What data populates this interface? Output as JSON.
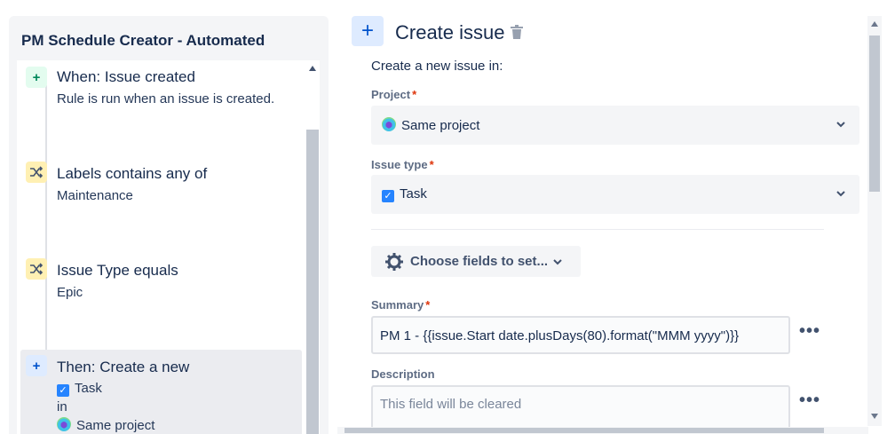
{
  "rule": {
    "title": "PM Schedule Creator - Automated",
    "steps": [
      {
        "icon": "plus-icon",
        "title": "When: Issue created",
        "subtitle": "Rule is run when an issue is created."
      },
      {
        "icon": "shuffle-icon",
        "title": "Labels contains any of",
        "subtitle": "Maintenance"
      },
      {
        "icon": "shuffle-icon",
        "title": "Issue Type equals",
        "subtitle": "Epic"
      },
      {
        "icon": "plus-icon",
        "title": "Then: Create a new",
        "line1": "Task",
        "line2": "in",
        "line3": "Same project"
      }
    ]
  },
  "panel": {
    "add_icon": "+",
    "title": "Create issue",
    "intro": "Create a new issue in:",
    "project_label": "Project",
    "project_value": "Same project",
    "issue_type_label": "Issue type",
    "issue_type_value": "Task",
    "choose_fields_label": "Choose fields to set...",
    "summary_label": "Summary",
    "summary_value": "PM 1 - {{issue.Start date.plusDays(80).format(\"MMM yyyy\")}}",
    "description_label": "Description",
    "description_placeholder": "This field will be cleared",
    "required_mark": "*",
    "more_label": "•••"
  },
  "colors": {
    "accent": "#0052cc",
    "trigger_bg": "#e3fcef",
    "condition_bg": "#fff0b3",
    "action_bg": "#deebff",
    "required": "#de350b"
  }
}
